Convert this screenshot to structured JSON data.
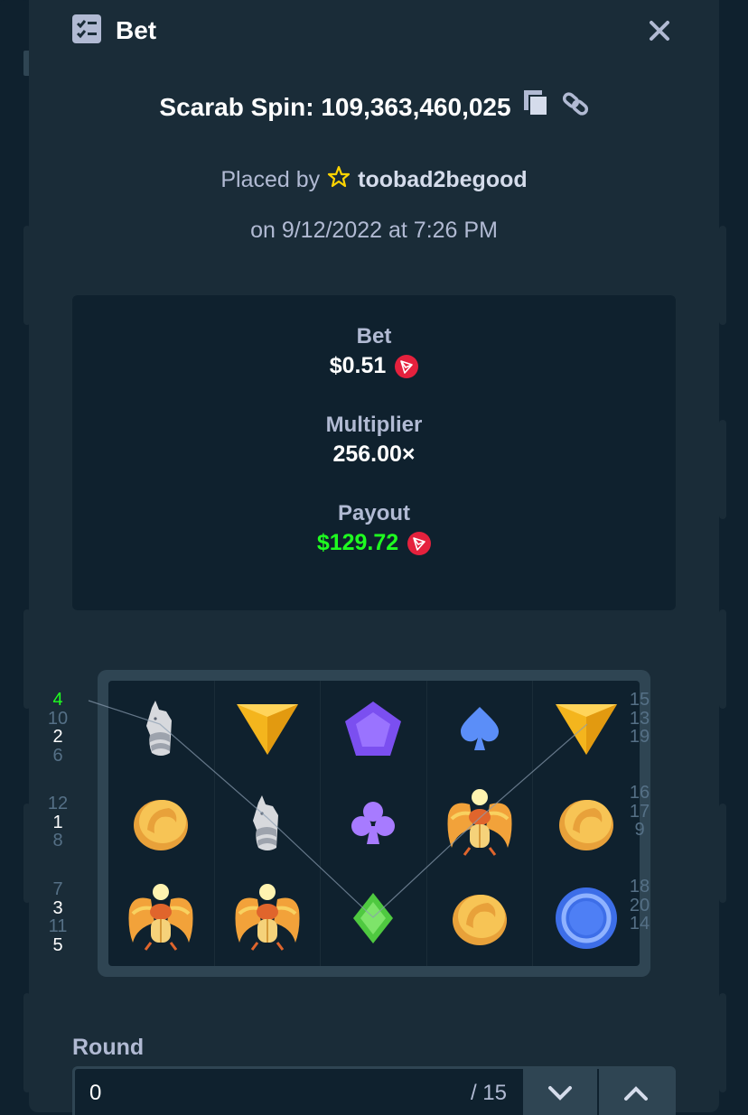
{
  "header": {
    "title": "Bet",
    "icon": "checklist-icon",
    "close_icon": "close-icon"
  },
  "game": {
    "title": "Scarab Spin: 109,363,460,025",
    "copy_icon": "copy-icon",
    "link_icon": "link-icon"
  },
  "placed": {
    "prefix": "Placed by",
    "user_icon": "star-icon",
    "username": "toobad2begood"
  },
  "date": "on 9/12/2022 at 7:26 PM",
  "stats": {
    "bet_label": "Bet",
    "bet_value": "$0.51",
    "multiplier_label": "Multiplier",
    "multiplier_value": "256.00×",
    "payout_label": "Payout",
    "payout_value": "$129.72",
    "currency_icon": "tron-icon",
    "payout_color": "#1fff20"
  },
  "paylines": {
    "left": [
      [
        "4",
        "10",
        "2",
        "6"
      ],
      [
        "12",
        "1",
        "8"
      ],
      [
        "7",
        "3",
        "11",
        "5"
      ]
    ],
    "right": [
      [
        "15",
        "13",
        "19"
      ],
      [
        "16",
        "17",
        "9"
      ],
      [
        "18",
        "20",
        "14"
      ]
    ]
  },
  "reels": [
    [
      "wolf",
      "coin",
      "scarab"
    ],
    [
      "triangle",
      "wolf",
      "scarab"
    ],
    [
      "pentagon",
      "club",
      "diamond"
    ],
    [
      "spade",
      "scarab",
      "coin"
    ],
    [
      "triangle",
      "coin",
      "blue-chip"
    ]
  ],
  "round": {
    "label": "Round",
    "value": "0",
    "total": "/ 15",
    "down_icon": "chevron-down-icon",
    "up_icon": "chevron-up-icon"
  }
}
